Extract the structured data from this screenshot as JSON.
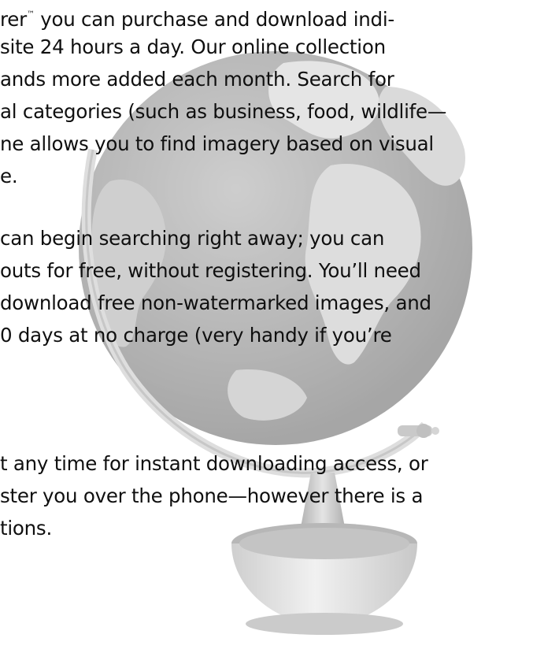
{
  "paragraphs": [
    {
      "lines": [
        {
          "pre": "rer",
          "tm": "™",
          "post": " you can purchase and download indi-"
        },
        {
          "text": " site 24 hours a day. Our online collection"
        },
        {
          "text": "ands more added each month. Search for"
        },
        {
          "text": "al categories (such as business, food, wildlife—"
        },
        {
          "text": "ne allows you to find imagery based on visual"
        },
        {
          "text": "e."
        }
      ]
    },
    {
      "lines": [
        {
          "text": " can begin searching right away; you can"
        },
        {
          "text": "outs for free, without registering.  You’ll need"
        },
        {
          "text": "download free non-watermarked images, and"
        },
        {
          "text": "0 days at no charge (very handy if you’re"
        }
      ]
    },
    {
      "lines": [
        {
          "text": "t any time for instant downloading access, or"
        },
        {
          "text": "ster you over the phone—however there is a"
        },
        {
          "text": "tions."
        }
      ]
    }
  ],
  "illustration": {
    "icon": "globe-icon",
    "colors": {
      "ocean": "#8a8a8a",
      "land": "#b9b9b9",
      "meridian": "#bdbdbd",
      "base": "#9a9a9a"
    }
  }
}
